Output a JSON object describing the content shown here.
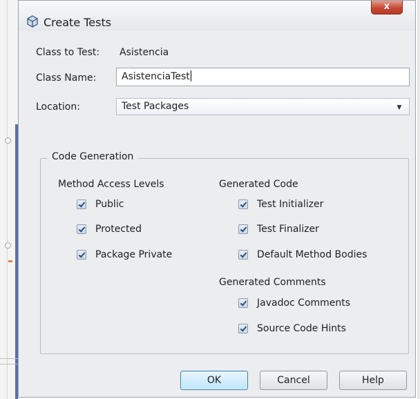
{
  "dialog": {
    "title": "Create Tests",
    "close_glyph": "x",
    "title_icon": "cube-icon"
  },
  "class_to_test": {
    "label": "Class to Test:",
    "value": "Asistencia"
  },
  "class_name": {
    "label": "Class Name:",
    "value": "AsistenciaTest"
  },
  "location": {
    "label": "Location:",
    "value": "Test Packages"
  },
  "code_generation": {
    "title": "Code Generation",
    "method_access": {
      "title": "Method Access Levels",
      "items": [
        {
          "label": "Public",
          "checked": true
        },
        {
          "label": "Protected",
          "checked": true
        },
        {
          "label": "Package Private",
          "checked": true
        }
      ]
    },
    "generated_code": {
      "title": "Generated Code",
      "items": [
        {
          "label": "Test Initializer",
          "checked": true
        },
        {
          "label": "Test Finalizer",
          "checked": true
        },
        {
          "label": "Default Method Bodies",
          "checked": true
        }
      ]
    },
    "generated_comments": {
      "title": "Generated Comments",
      "items": [
        {
          "label": "Javadoc Comments",
          "checked": true
        },
        {
          "label": "Source Code Hints",
          "checked": true
        }
      ]
    }
  },
  "buttons": {
    "ok": "OK",
    "cancel": "Cancel",
    "help": "Help"
  },
  "colors": {
    "window_bg": "#ecedef",
    "close_red": "#c44a36",
    "default_button": "#bee6fd"
  }
}
